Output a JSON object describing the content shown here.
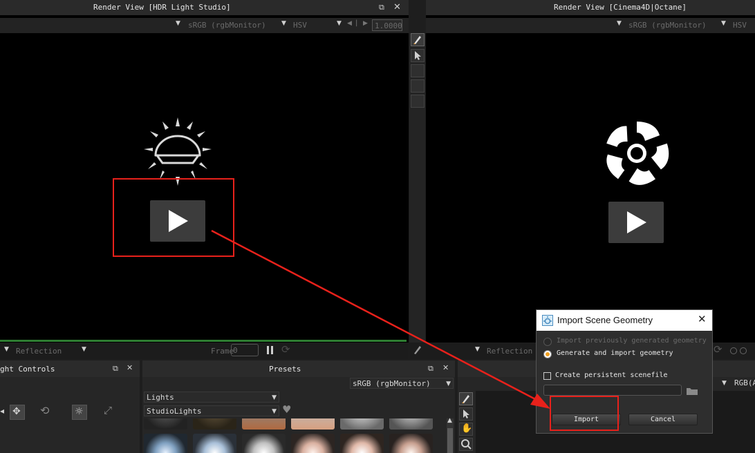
{
  "left_view": {
    "title": "Render View [HDR Light Studio]",
    "color_space": "sRGB (rgbMonitor)",
    "color_model": "HSV",
    "exposure_value": "1.0000",
    "bottom_mode": "Reflection",
    "frame_label": "Frame",
    "frame_value": "0"
  },
  "right_view": {
    "title": "Render View [Cinema4D|Octane]",
    "color_space": "sRGB (rgbMonitor)",
    "color_model": "HSV",
    "bottom_mode": "Reflection"
  },
  "light_controls": {
    "title": "ght Controls"
  },
  "presets": {
    "title": "Presets",
    "color_space": "sRGB (rgbMonitor)",
    "category": "Lights",
    "subcategory": "StudioLights"
  },
  "right_panel": {
    "color_space": "RGB(A"
  },
  "dialog": {
    "title": "Import Scene Geometry",
    "option1": "Import previously generated geometry",
    "option2": "Generate and import geometry",
    "checkbox_label": "Create persistent scenefile",
    "path_value": "",
    "import_label": "Import",
    "cancel_label": "Cancel"
  },
  "icons": [
    "restore-icon",
    "close-icon",
    "play-icon",
    "pause-icon",
    "refresh-icon",
    "sun-dome-icon",
    "octane-logo-icon",
    "brush-icon",
    "cursor-icon",
    "hand-icon",
    "zoom-icon",
    "heart-icon",
    "folder-icon"
  ],
  "colors": {
    "highlight": "#e8211b",
    "progress": "#2e7d32",
    "radio_selected": "#f0a020"
  }
}
